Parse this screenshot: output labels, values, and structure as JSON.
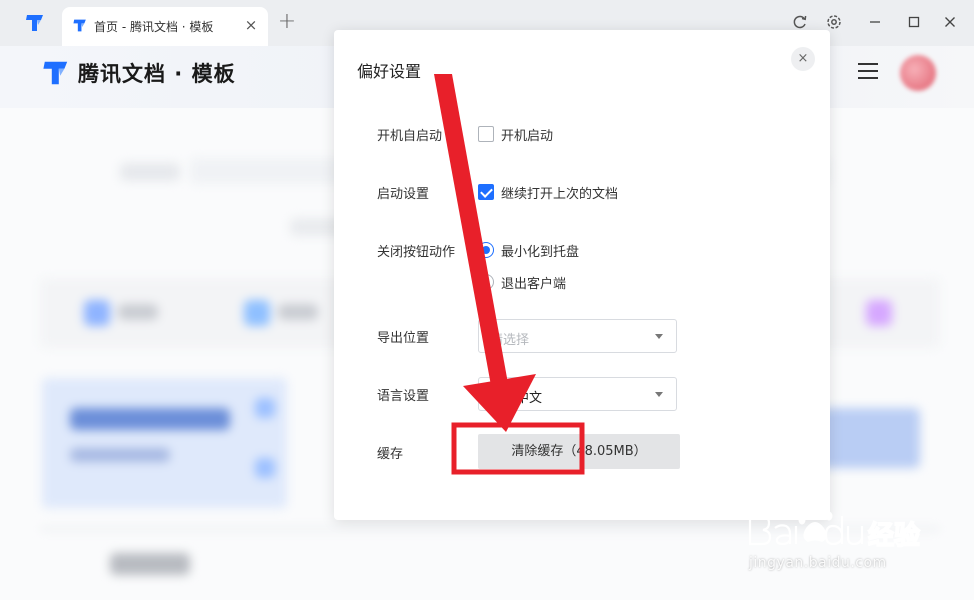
{
  "window": {
    "tab_title": "首页 - 腾讯文档 · 模板",
    "tab_close": "×",
    "new_tab": "+",
    "controls": [
      "refresh-icon",
      "settings-icon",
      "minimize-icon",
      "maximize-icon",
      "close-icon"
    ]
  },
  "app": {
    "brand_name": "腾讯文档 · 模板",
    "brand_color": "#1e6fff"
  },
  "dialog": {
    "title": "偏好设置",
    "close": "×",
    "startup": {
      "label": "开机自启动",
      "option": "开机启动",
      "checked": false
    },
    "launch": {
      "label": "启动设置",
      "option": "继续打开上次的文档",
      "checked": true
    },
    "close_action": {
      "label": "关闭按钮动作",
      "options": [
        "最小化到托盘",
        "退出客户端"
      ],
      "selected": "最小化到托盘"
    },
    "export": {
      "label": "导出位置",
      "placeholder": "请选择"
    },
    "language": {
      "label": "语言设置",
      "value": "简体中文"
    },
    "cache": {
      "label": "缓存",
      "button": "清除缓存（48.05MB）"
    }
  },
  "annotation": {
    "color": "#e8202a"
  },
  "watermark": {
    "brand": "Baidu经验",
    "url": "jingyan.baidu.com"
  }
}
